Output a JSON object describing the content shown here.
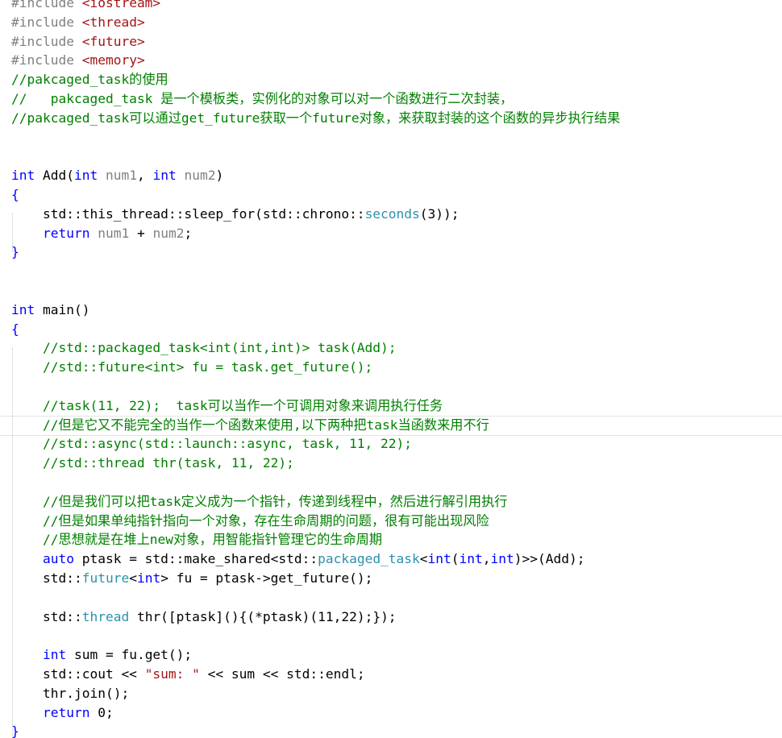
{
  "editor": {
    "current_line_index": 22,
    "lines": [
      [
        {
          "t": "#include ",
          "c": "pp"
        },
        {
          "t": "<iostream>",
          "c": "inc"
        }
      ],
      [
        {
          "t": "#include ",
          "c": "pp"
        },
        {
          "t": "<thread>",
          "c": "inc"
        }
      ],
      [
        {
          "t": "#include ",
          "c": "pp"
        },
        {
          "t": "<future>",
          "c": "inc"
        }
      ],
      [
        {
          "t": "#include ",
          "c": "pp"
        },
        {
          "t": "<memory>",
          "c": "inc"
        }
      ],
      [
        {
          "t": "//pakcaged_task的使用",
          "c": "cm"
        }
      ],
      [
        {
          "t": "//   pakcaged_task 是一个模板类，实例化的对象可以对一个函数进行二次封装，",
          "c": "cm"
        }
      ],
      [
        {
          "t": "//pakcaged_task可以通过get_future获取一个future对象，来获取封装的这个函数的异步执行结果",
          "c": "cm"
        }
      ],
      [],
      [],
      [
        {
          "t": "int",
          "c": "kw"
        },
        {
          "t": " Add(",
          "c": "fn"
        },
        {
          "t": "int",
          "c": "kw"
        },
        {
          "t": " ",
          "c": ""
        },
        {
          "t": "num1",
          "c": "pm"
        },
        {
          "t": ", ",
          "c": ""
        },
        {
          "t": "int",
          "c": "kw"
        },
        {
          "t": " ",
          "c": ""
        },
        {
          "t": "num2",
          "c": "pm"
        },
        {
          "t": ")",
          "c": ""
        }
      ],
      [
        {
          "t": "{",
          "c": "kw"
        }
      ],
      [
        {
          "t": "    std::this_thread::sleep_for(std::chrono::",
          "c": ""
        },
        {
          "t": "seconds",
          "c": "ty"
        },
        {
          "t": "(3));",
          "c": ""
        }
      ],
      [
        {
          "t": "    ",
          "c": ""
        },
        {
          "t": "return",
          "c": "kw"
        },
        {
          "t": " ",
          "c": ""
        },
        {
          "t": "num1",
          "c": "pm"
        },
        {
          "t": " + ",
          "c": ""
        },
        {
          "t": "num2",
          "c": "pm"
        },
        {
          "t": ";",
          "c": ""
        }
      ],
      [
        {
          "t": "}",
          "c": "kw"
        }
      ],
      [],
      [],
      [
        {
          "t": "int",
          "c": "kw"
        },
        {
          "t": " main()",
          "c": "fn"
        }
      ],
      [
        {
          "t": "{",
          "c": "kw"
        }
      ],
      [
        {
          "t": "    //std::packaged_task<int(int,int)> task(Add);",
          "c": "cm"
        }
      ],
      [
        {
          "t": "    //std::future<int> fu = task.get_future();",
          "c": "cm"
        }
      ],
      [],
      [
        {
          "t": "    //task(11, 22);  task可以当作一个可调用对象来调用执行任务",
          "c": "cm"
        }
      ],
      [
        {
          "t": "    //但是它又不能完全的当作一个函数来使用,以下两种把task当函数来用不行",
          "c": "cm"
        }
      ],
      [
        {
          "t": "    //std::async(std::launch::async, task, 11, 22);",
          "c": "cm"
        }
      ],
      [
        {
          "t": "    //std::thread thr(task, 11, 22);",
          "c": "cm"
        }
      ],
      [],
      [
        {
          "t": "    //但是我们可以把task定义成为一个指针，传递到线程中，然后进行解引用执行",
          "c": "cm"
        }
      ],
      [
        {
          "t": "    //但是如果单纯指针指向一个对象，存在生命周期的问题，很有可能出现风险",
          "c": "cm"
        }
      ],
      [
        {
          "t": "    //思想就是在堆上new对象，用智能指针管理它的生命周期",
          "c": "cm"
        }
      ],
      [
        {
          "t": "    ",
          "c": ""
        },
        {
          "t": "auto",
          "c": "kw"
        },
        {
          "t": " ptask = std::make_shared<std::",
          "c": ""
        },
        {
          "t": "packaged_task",
          "c": "ty"
        },
        {
          "t": "<",
          "c": ""
        },
        {
          "t": "int",
          "c": "kw"
        },
        {
          "t": "(",
          "c": ""
        },
        {
          "t": "int",
          "c": "kw"
        },
        {
          "t": ",",
          "c": ""
        },
        {
          "t": "int",
          "c": "kw"
        },
        {
          "t": ")>>(Add);",
          "c": ""
        }
      ],
      [
        {
          "t": "    std::",
          "c": ""
        },
        {
          "t": "future",
          "c": "ty"
        },
        {
          "t": "<",
          "c": ""
        },
        {
          "t": "int",
          "c": "kw"
        },
        {
          "t": "> fu = ptask->get_future();",
          "c": ""
        }
      ],
      [],
      [
        {
          "t": "    std::",
          "c": ""
        },
        {
          "t": "thread",
          "c": "ty"
        },
        {
          "t": " thr([ptask](){(*ptask)(11,22);});",
          "c": ""
        }
      ],
      [],
      [
        {
          "t": "    ",
          "c": ""
        },
        {
          "t": "int",
          "c": "kw"
        },
        {
          "t": " sum = fu.get();",
          "c": ""
        }
      ],
      [
        {
          "t": "    std::cout << ",
          "c": ""
        },
        {
          "t": "\"sum: \"",
          "c": "str"
        },
        {
          "t": " << sum << std::endl;",
          "c": ""
        }
      ],
      [
        {
          "t": "    thr.join();",
          "c": ""
        }
      ],
      [
        {
          "t": "    ",
          "c": ""
        },
        {
          "t": "return",
          "c": "kw"
        },
        {
          "t": " 0;",
          "c": ""
        }
      ],
      [
        {
          "t": "}",
          "c": "kw"
        }
      ]
    ]
  },
  "colors": {
    "background": "#ffffff",
    "keyword": "#0000ff",
    "comment": "#008000",
    "include_path": "#a31515",
    "preprocessor": "#808080",
    "type": "#2b91af",
    "parameter": "#808080",
    "string": "#a31515"
  }
}
